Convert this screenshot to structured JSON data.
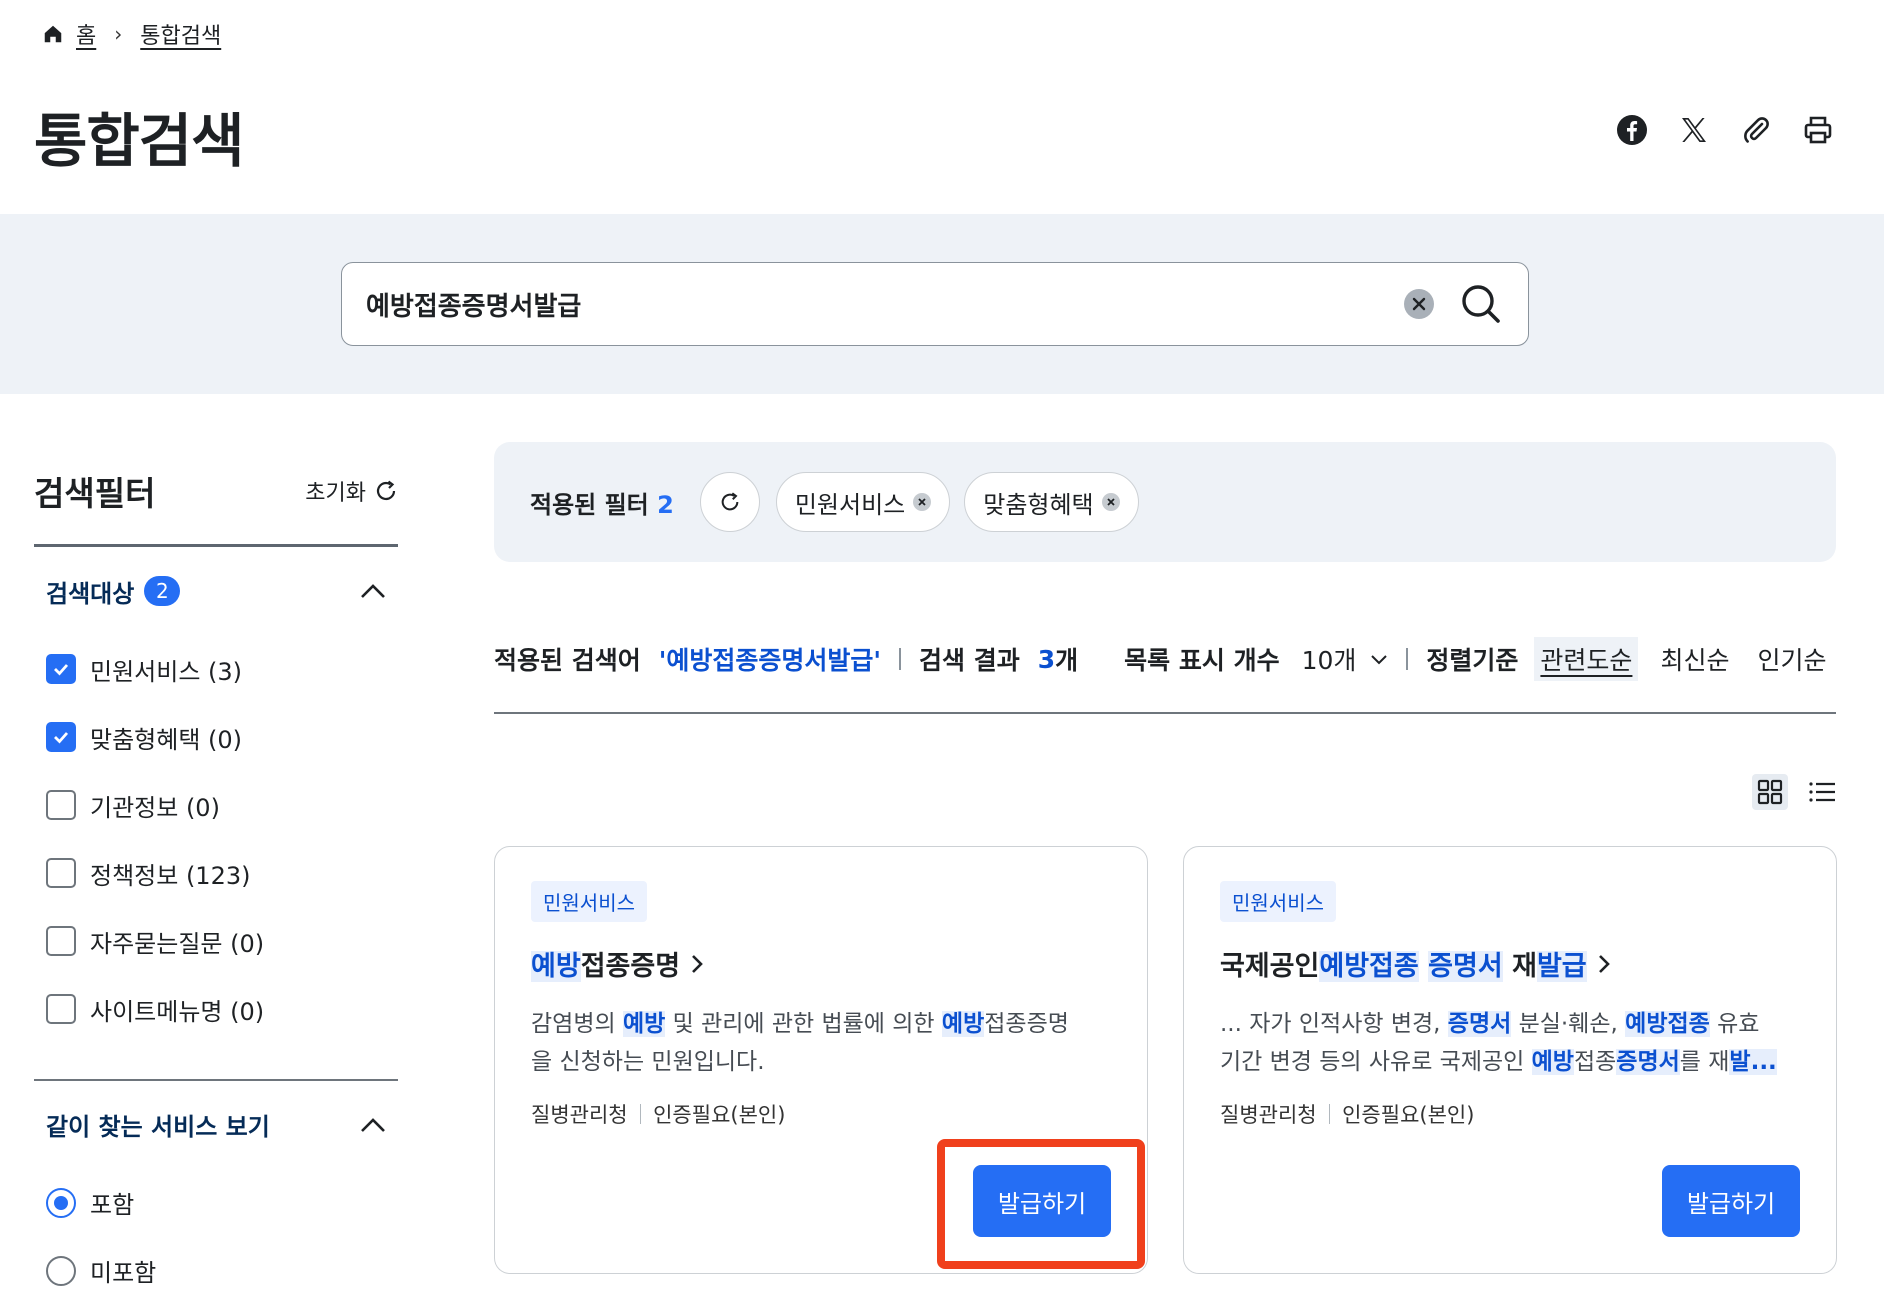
{
  "breadcrumb": {
    "home": "홈",
    "current": "통합검색"
  },
  "page_title": "통합검색",
  "share_tools": [
    {
      "icon": "facebook-icon"
    },
    {
      "icon": "x-twitter-icon"
    },
    {
      "icon": "paperclip-icon"
    },
    {
      "icon": "printer-icon"
    }
  ],
  "search": {
    "value": "예방접종증명서발급"
  },
  "sidebar": {
    "title": "검색필터",
    "reset_label": "초기화",
    "target_group": {
      "title": "검색대상",
      "count": "2",
      "items": [
        {
          "label": "민원서비스 (3)",
          "checked": true
        },
        {
          "label": "맞춤형혜택 (0)",
          "checked": true
        },
        {
          "label": "기관정보 (0)",
          "checked": false
        },
        {
          "label": "정책정보 (123)",
          "checked": false
        },
        {
          "label": "자주묻는질문 (0)",
          "checked": false
        },
        {
          "label": "사이트메뉴명 (0)",
          "checked": false
        }
      ]
    },
    "related_group": {
      "title": "같이 찾는 서비스 보기",
      "options": [
        {
          "label": "포함",
          "selected": true
        },
        {
          "label": "미포함",
          "selected": false
        }
      ]
    }
  },
  "applied_filters": {
    "label": "적용된 필터",
    "count": "2",
    "chips": [
      "민원서비스",
      "맞춤형혜택"
    ]
  },
  "result_bar": {
    "query_label": "적용된 검색어",
    "query_value": "'예방접종증명서발급'",
    "result_label": "검색 결과",
    "result_count": "3",
    "result_unit": "개",
    "rows_label": "목록 표시 개수",
    "rows_value": "10개",
    "sort_label": "정렬기준",
    "sort_options": [
      "관련도순",
      "최신순",
      "인기순"
    ],
    "sort_active": "관련도순"
  },
  "cards": [
    {
      "tag": "민원서비스",
      "title_parts": {
        "hl1": "예방",
        "rest": "접종증명"
      },
      "desc_line1": {
        "a": "감염병의 ",
        "hl1": "예방",
        "b": " 및 관리에 관한 법률에 의한 ",
        "hl2": "예방",
        "c": "접종증명"
      },
      "desc_line2": "을 신청하는 민원입니다.",
      "agency": "질병관리청",
      "auth": "인증필요(본인)",
      "button": "발급하기"
    },
    {
      "tag": "민원서비스",
      "title_parts": {
        "pre": "국제공인",
        "hl1": "예방접종",
        "sp": " ",
        "hl2": "증명서",
        "mid": " 재",
        "hl3": "발급"
      },
      "desc_line1": {
        "a": "... 자가 인적사항 변경, ",
        "hl1": "증명서",
        "b": " 분실·훼손, ",
        "hl2": "예방접종",
        "c": " 유효"
      },
      "desc_line2": {
        "a": "기간 변경 등의 사유로 국제공인 ",
        "hl1": "예방",
        "b": "접종",
        "hl2": "증명서",
        "c": "를 재",
        "hl3": "발..."
      },
      "agency": "질병관리청",
      "auth": "인증필요(본인)",
      "button": "발급하기"
    }
  ],
  "colors": {
    "accent": "#256ef4",
    "highlight_text": "#0b50d0",
    "focus_ring": "#f0401c",
    "band_bg": "#eef2f7"
  }
}
